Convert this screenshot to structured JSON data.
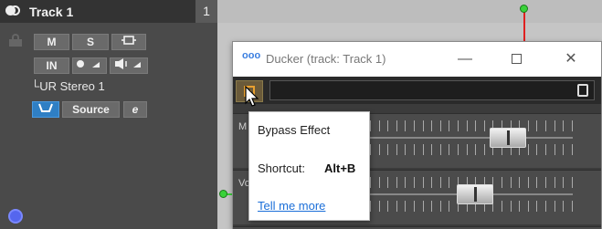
{
  "track": {
    "name": "Track 1",
    "number": "1",
    "buttons": {
      "mute": "M",
      "solo": "S",
      "input": "IN",
      "source": "Source",
      "edit": "e"
    },
    "output": "└UR Stereo 1"
  },
  "plugin_window": {
    "title": "Ducker (track: Track 1)",
    "title_icon": "ooo",
    "controls": {
      "minimize": "—",
      "close": "✕"
    },
    "rows": [
      {
        "label": "M",
        "fader_value": 0.72
      },
      {
        "label": "Vo",
        "fader_value": 0.52
      }
    ]
  },
  "tooltip": {
    "title": "Bypass Effect",
    "shortcut_label": "Shortcut:",
    "shortcut_key": "Alt+B",
    "link": "Tell me more"
  },
  "colors": {
    "accent_blue": "#2f7fc4",
    "playhead": "#e02020",
    "automation": "#3ad23a",
    "link": "#1a6ed8"
  }
}
